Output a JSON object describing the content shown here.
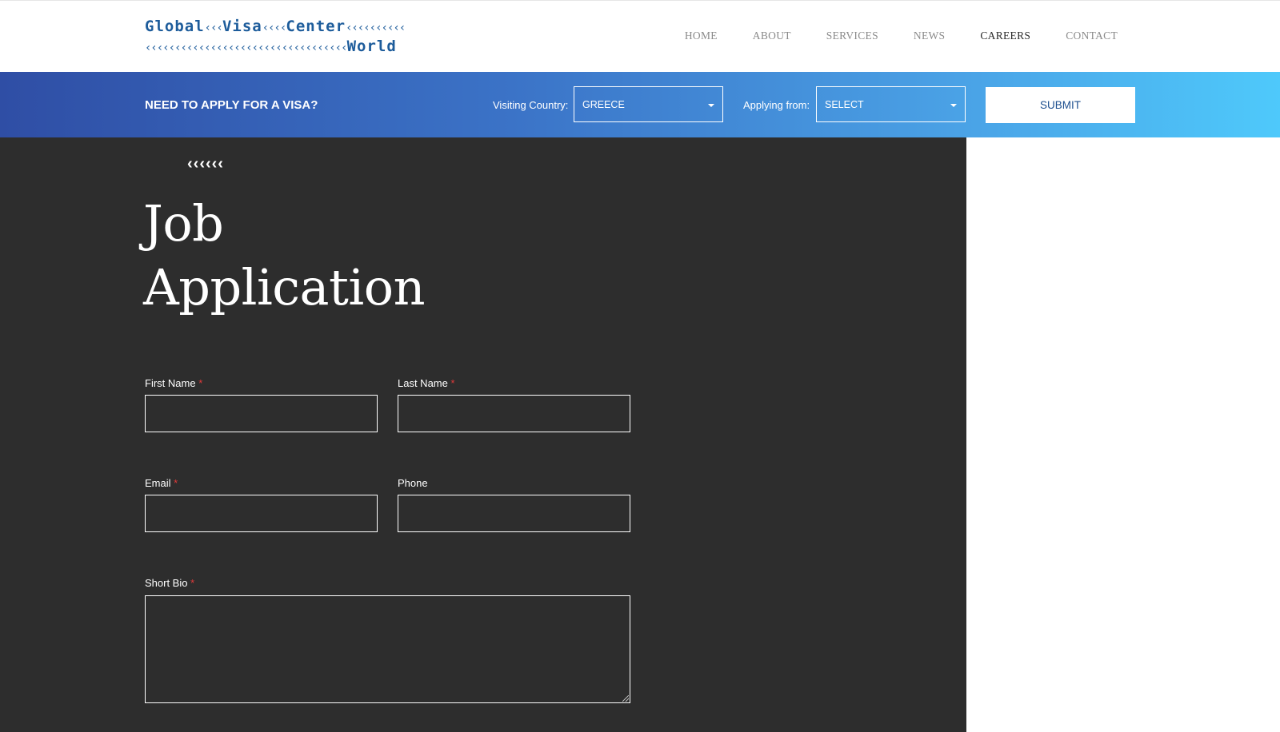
{
  "logo": {
    "line1_words": [
      "Global",
      "Visa",
      "Center"
    ],
    "line1_chevrons": [
      "‹‹‹",
      "‹‹‹‹",
      "‹‹‹‹‹‹‹‹‹‹"
    ],
    "line2_chevrons": "‹‹‹‹‹‹‹‹‹‹‹‹‹‹‹‹‹‹‹‹‹‹‹‹‹‹‹‹‹‹‹‹‹‹",
    "line2_word": "World"
  },
  "nav": {
    "items": [
      {
        "label": "HOME",
        "active": false
      },
      {
        "label": "ABOUT",
        "active": false
      },
      {
        "label": "SERVICES",
        "active": false
      },
      {
        "label": "NEWS",
        "active": false
      },
      {
        "label": "CAREERS",
        "active": true
      },
      {
        "label": "CONTACT",
        "active": false
      }
    ]
  },
  "visa_bar": {
    "title": "NEED TO APPLY FOR A VISA?",
    "visiting_label": "Visiting Country:",
    "visiting_value": "GREECE",
    "applying_label": "Applying from:",
    "applying_value": "SELECT",
    "submit_label": "SUBMIT"
  },
  "main": {
    "chevrons": "‹‹‹‹‹‹",
    "title_line1": "Job",
    "title_line2": "Application",
    "fields": {
      "first_name": {
        "label": "First Name",
        "required": "*"
      },
      "last_name": {
        "label": "Last Name",
        "required": "*"
      },
      "email": {
        "label": "Email",
        "required": "*"
      },
      "phone": {
        "label": "Phone"
      },
      "short_bio": {
        "label": "Short Bio",
        "required": "*"
      }
    }
  },
  "colors": {
    "brand_blue": "#1d5c9b",
    "bar_gradient_start": "#2f4ea5",
    "bar_gradient_end": "#4ec9fb",
    "dark_panel": "#2d2d2d",
    "required": "#e03a3a"
  }
}
